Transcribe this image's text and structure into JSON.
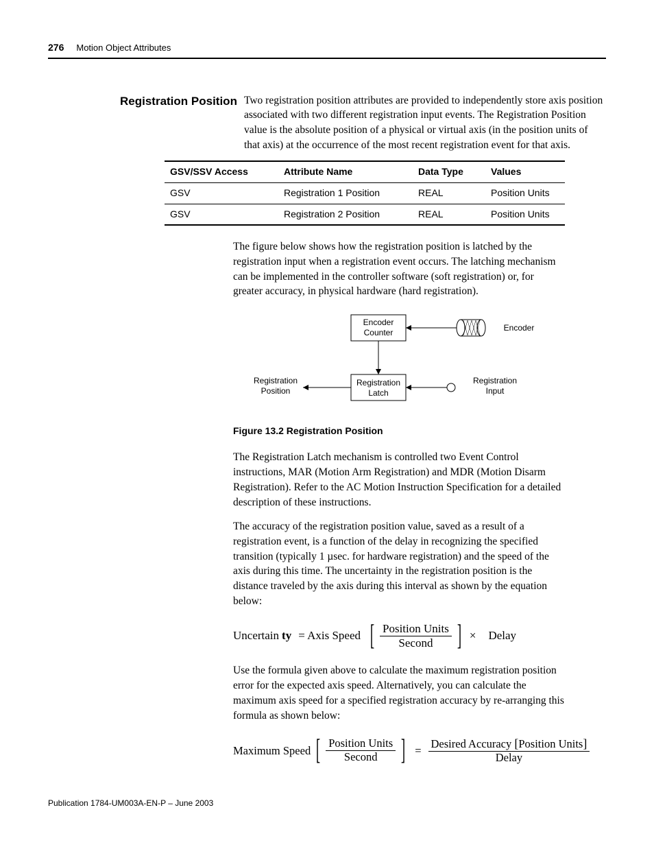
{
  "header": {
    "pageNumber": "276",
    "chapter": "Motion Object Attributes"
  },
  "section": {
    "heading": "Registration Position",
    "intro": "Two registration position attributes are provided to independently store axis position associated with two different registration input events. The Registration Position value is the absolute position of a physical or virtual axis (in the position units of that axis) at the occurrence of the most recent registration event for that axis."
  },
  "table": {
    "headers": {
      "access": "GSV/SSV Access",
      "attr": "Attribute Name",
      "type": "Data Type",
      "values": "Values"
    },
    "rows": [
      {
        "access": "GSV",
        "attr": "Registration 1 Position",
        "type": "REAL",
        "values": "Position Units"
      },
      {
        "access": "GSV",
        "attr": "Registration 2 Position",
        "type": "REAL",
        "values": "Position Units"
      }
    ]
  },
  "para1": "The figure below shows how the registration position is latched by the registration input when a registration event occurs. The latching mechanism can be implemented in the controller software (soft registration) or, for greater accuracy, in physical hardware (hard registration).",
  "figure": {
    "encoderCounter": "Encoder\nCounter",
    "encoder": "Encoder",
    "regPosition": "Registration\nPosition",
    "regLatch": "Registration\nLatch",
    "regInput": "Registration\nInput",
    "caption": "Figure 13.2 Registration Position"
  },
  "para2": "The Registration Latch mechanism is controlled two Event Control instructions, MAR (Motion Arm Registration) and MDR (Motion Disarm Registration). Refer to the AC Motion Instruction Specification for a detailed description of these instructions.",
  "para3": "The accuracy of the registration position value, saved as a result of a registration event, is a function of the delay in recognizing the specified transition (typically 1 µsec. for hardware registration) and the speed of the axis during this time. The uncertainty in the registration position is the distance traveled by the axis during this interval as shown by the equation below:",
  "eq1": {
    "lhs": "Uncertain",
    "lhs_bold": "ty",
    "eq": "= Axis Speed",
    "fracNum": "Position Units",
    "fracDen": "Second",
    "times": "×",
    "rhs": "Delay"
  },
  "para4": "Use the formula given above to calculate the maximum registration position error for the expected axis speed. Alternatively, you can calculate the maximum axis speed for a specified registration accuracy by re-arranging this formula as shown below:",
  "eq2": {
    "lhs": "Maximum Speed",
    "fracNum1": "Position Units",
    "fracDen1": "Second",
    "eq": "=",
    "fracNum2a": "Desired  Accuracy",
    "fracNum2b": "Position Units",
    "fracDen2": "Delay"
  },
  "footer": "Publication 1784-UM003A-EN-P – June 2003"
}
